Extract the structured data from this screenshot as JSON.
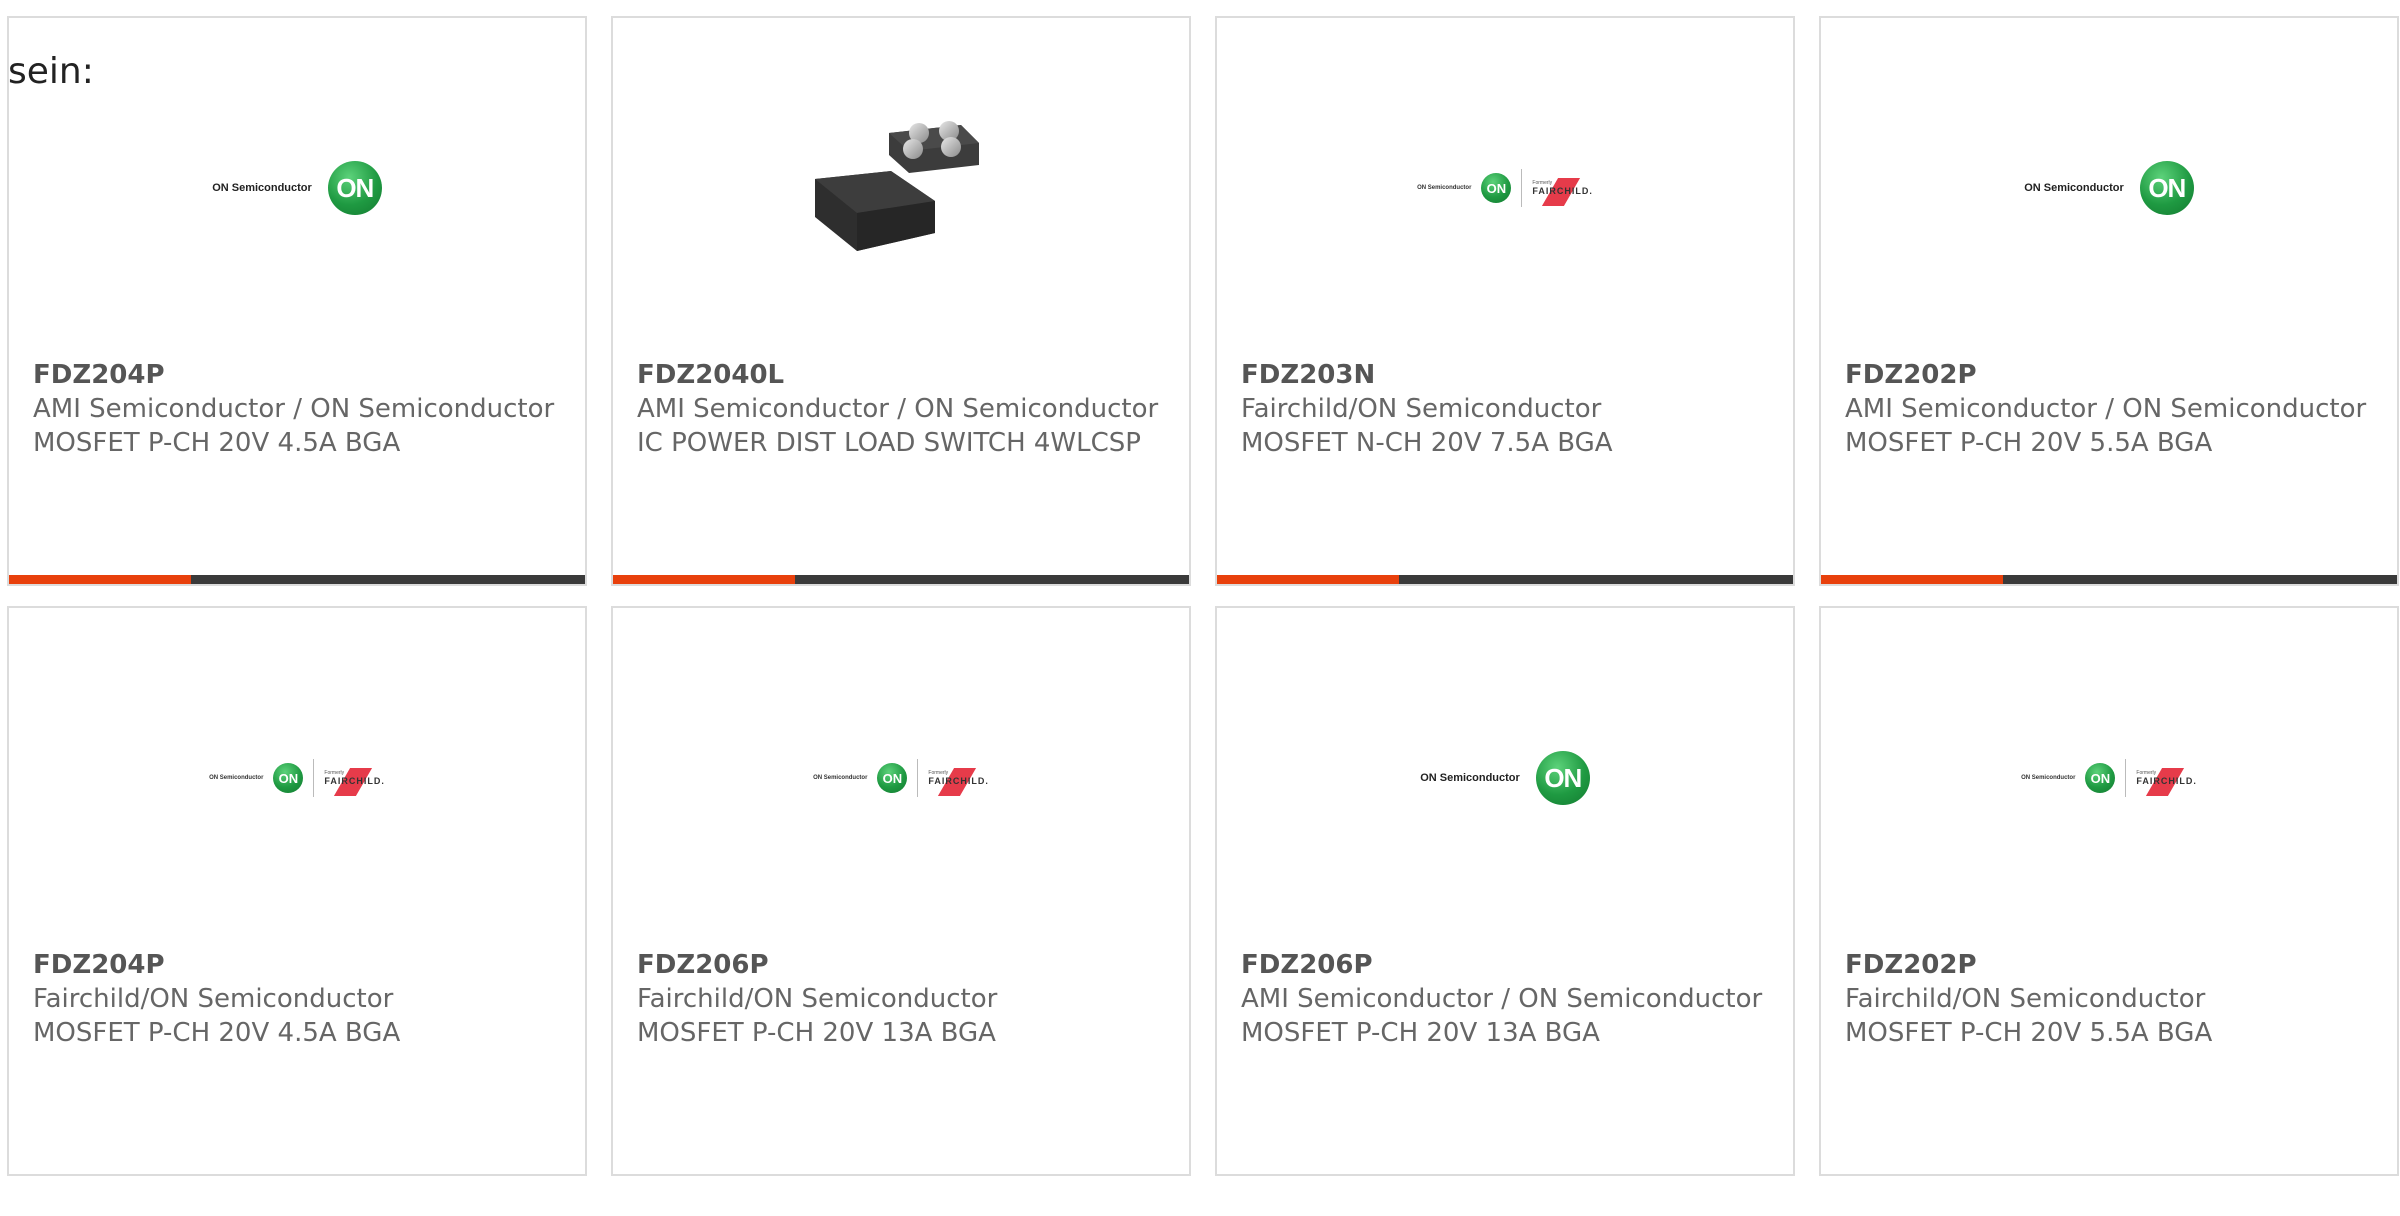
{
  "page": {
    "intro": "sein:"
  },
  "colors": {
    "accent": "#e8400c",
    "bar": "#3a3a3a",
    "border": "#dcdcdc",
    "text": "#666666"
  },
  "cards": [
    {
      "part": "FDZ204P",
      "maker": "AMI Semiconductor / ON Semiconductor",
      "desc": "MOSFET P-CH 20V 4.5A BGA",
      "image": "on-semiconductor-logo",
      "logo_text": "ON Semiconductor",
      "logo_mark": "ON"
    },
    {
      "part": "FDZ2040L",
      "maker": "AMI Semiconductor / ON Semiconductor",
      "desc": "IC POWER DIST LOAD SWITCH 4WLCSP",
      "image": "chip-package-photo"
    },
    {
      "part": "FDZ203N",
      "maker": "Fairchild/ON Semiconductor",
      "desc": "MOSFET N-CH 20V 7.5A BGA",
      "image": "on-fairchild-logo",
      "logo_text": "ON Semiconductor",
      "logo_mark": "ON",
      "formerly": "Formerly",
      "fairchild": "FAIRCHILD."
    },
    {
      "part": "FDZ202P",
      "maker": "AMI Semiconductor / ON Semiconductor",
      "desc": "MOSFET P-CH 20V 5.5A BGA",
      "image": "on-semiconductor-logo",
      "logo_text": "ON Semiconductor",
      "logo_mark": "ON"
    },
    {
      "part": "FDZ204P",
      "maker": "Fairchild/ON Semiconductor",
      "desc": "MOSFET P-CH 20V 4.5A BGA",
      "image": "on-fairchild-logo",
      "logo_text": "ON Semiconductor",
      "logo_mark": "ON",
      "formerly": "Formerly",
      "fairchild": "FAIRCHILD."
    },
    {
      "part": "FDZ206P",
      "maker": "Fairchild/ON Semiconductor",
      "desc": "MOSFET P-CH 20V 13A BGA",
      "image": "on-fairchild-logo",
      "logo_text": "ON Semiconductor",
      "logo_mark": "ON",
      "formerly": "Formerly",
      "fairchild": "FAIRCHILD."
    },
    {
      "part": "FDZ206P",
      "maker": "AMI Semiconductor / ON Semiconductor",
      "desc": "MOSFET P-CH 20V 13A BGA",
      "image": "on-semiconductor-logo",
      "logo_text": "ON Semiconductor",
      "logo_mark": "ON"
    },
    {
      "part": "FDZ202P",
      "maker": "Fairchild/ON Semiconductor",
      "desc": "MOSFET P-CH 20V 5.5A BGA",
      "image": "on-fairchild-logo",
      "logo_text": "ON Semiconductor",
      "logo_mark": "ON",
      "formerly": "Formerly",
      "fairchild": "FAIRCHILD."
    }
  ]
}
